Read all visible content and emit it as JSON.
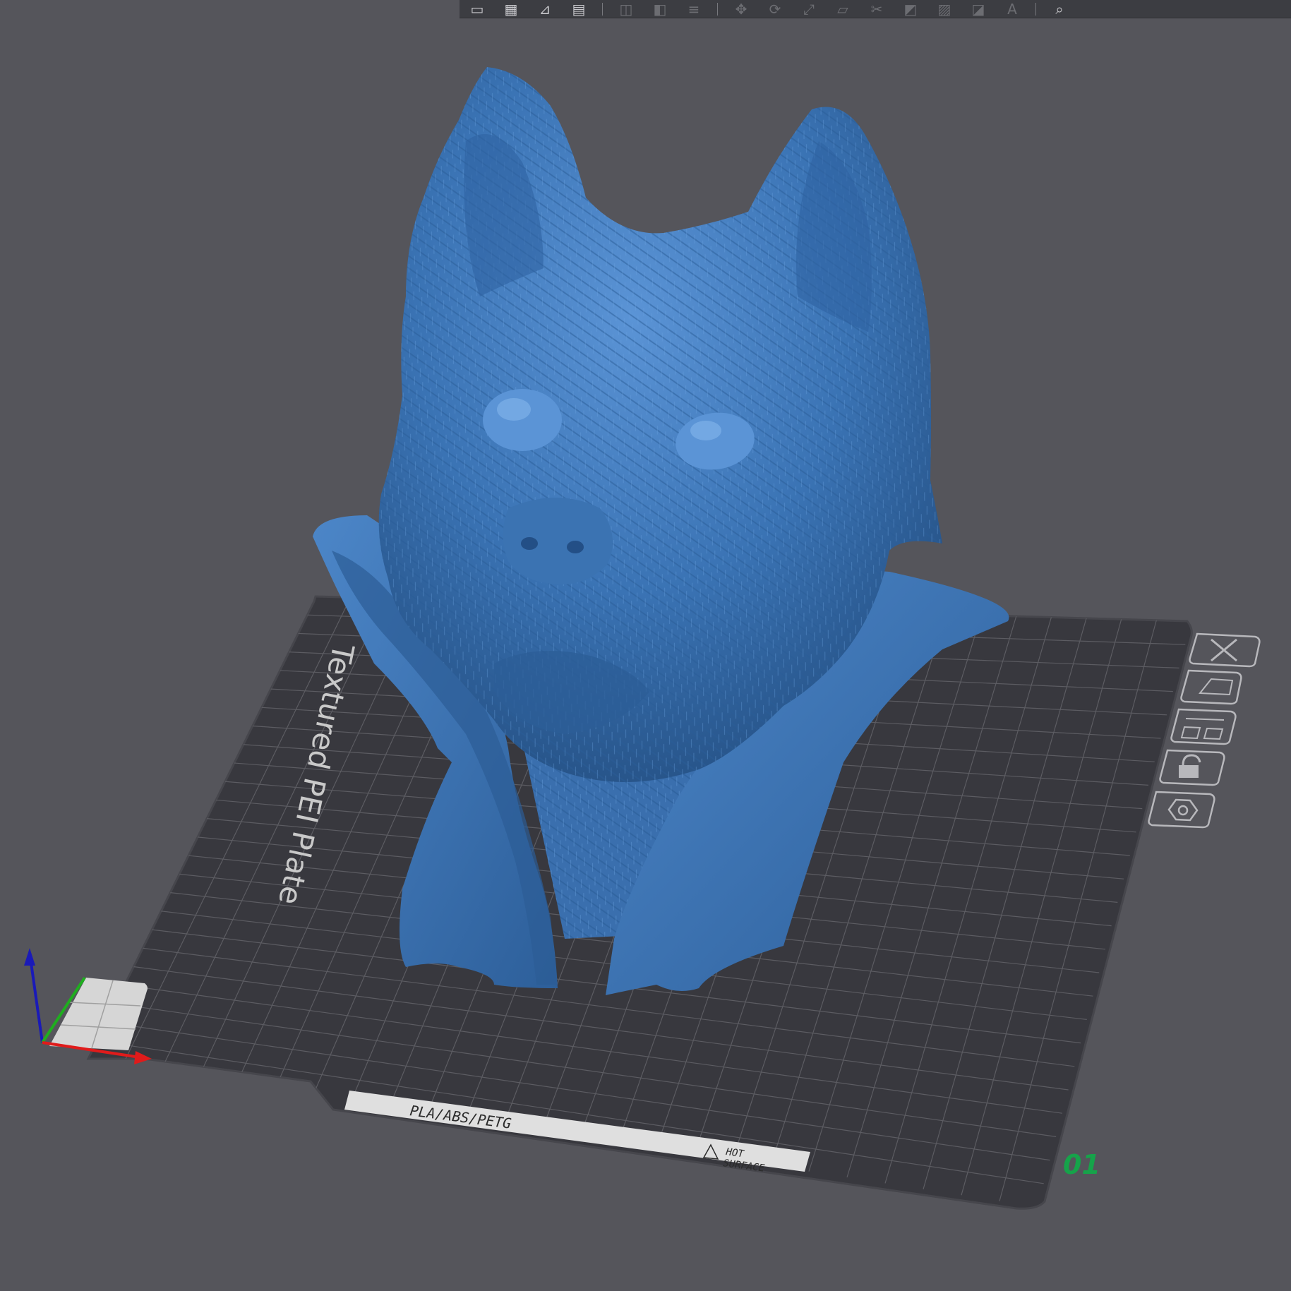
{
  "toolbar": {
    "buttons": [
      {
        "name": "add-object-icon"
      },
      {
        "name": "add-plate-icon"
      },
      {
        "name": "orient-icon"
      },
      {
        "name": "arrange-icon"
      },
      {
        "name": "split-objects-icon"
      },
      {
        "name": "split-parts-icon"
      },
      {
        "name": "layers-icon"
      },
      {
        "name": "move-icon"
      },
      {
        "name": "rotate-icon"
      },
      {
        "name": "scale-icon"
      },
      {
        "name": "lay-on-face-icon"
      },
      {
        "name": "cut-icon"
      },
      {
        "name": "mesh-boolean-icon"
      },
      {
        "name": "support-paint-icon"
      },
      {
        "name": "seam-paint-icon"
      },
      {
        "name": "text-emboss-icon"
      },
      {
        "name": "measure-icon"
      }
    ]
  },
  "plate": {
    "name": "Textured PEI Plate",
    "number": "01",
    "number_color": "#16a34a",
    "label_strip": "PLA/ABS/PETG",
    "warning": [
      "HOT",
      "SURFACE"
    ]
  },
  "plate_buttons": [
    {
      "name": "delete-plate-icon"
    },
    {
      "name": "auto-orient-plate-icon"
    },
    {
      "name": "arrange-plate-icon"
    },
    {
      "name": "lock-plate-icon"
    },
    {
      "name": "plate-settings-icon"
    }
  ],
  "model": {
    "color": "#3a73b4",
    "name": "dog-bust-model"
  },
  "colors": {
    "background": "#55555b",
    "bed": "#38383e",
    "grid": "#5c5c62",
    "axis_x": "#e01b1b",
    "axis_y": "#1fae1f",
    "axis_z": "#1a1ab8"
  }
}
